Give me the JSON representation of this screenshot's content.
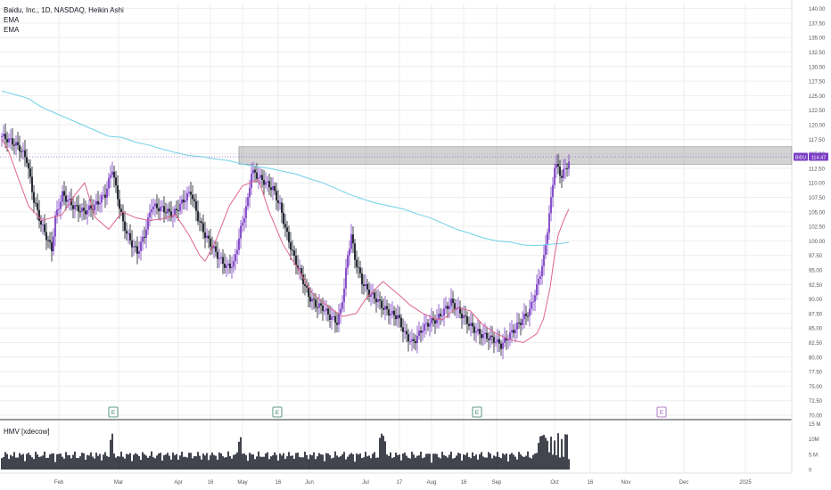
{
  "header": {
    "title": "Baidu, Inc., 1D, NASDAQ, Heikin Ashi",
    "ema_labels": [
      "EMA",
      "EMA"
    ]
  },
  "volume_pane": {
    "label": "HMV [xdecow]"
  },
  "colors": {
    "bull": "#7b3fc4",
    "bear": "#131722",
    "ema_fast": "#e0658a",
    "ema_slow": "#6fd0e8",
    "zone": "#9e9e9e",
    "grid": "#eeeeee",
    "price_tag": "#7b3fc4"
  },
  "chart_data": [
    {
      "type": "candlestick",
      "title": "Baidu, Inc., 1D, NASDAQ, Heikin Ashi",
      "x_tick_labels": [
        "Feb",
        "Mar",
        "Apr",
        "16",
        "May",
        "16",
        "Jun",
        "Jul",
        "17",
        "Aug",
        "16",
        "Sep",
        "Oct",
        "16",
        "Nov",
        "Dec",
        "2025"
      ],
      "y_tick_labels": [
        "70.00",
        "72.50",
        "75.00",
        "77.50",
        "80.00",
        "82.50",
        "85.00",
        "87.50",
        "90.00",
        "92.50",
        "95.00",
        "97.50",
        "100.00",
        "102.50",
        "105.00",
        "107.50",
        "110.00",
        "112.50",
        "115.00",
        "117.50",
        "120.00",
        "122.50",
        "125.00",
        "127.50",
        "130.00",
        "132.50",
        "135.00",
        "137.50",
        "140.00"
      ],
      "ylim": [
        70,
        140
      ],
      "grid": true,
      "last_price": {
        "symbol": "BIDU",
        "value": "114.47"
      },
      "resistance_zone": [
        113.2,
        116.2
      ],
      "earnings_markers": [
        {
          "label": "E",
          "date": "2024-03-12",
          "status": "past"
        },
        {
          "label": "E",
          "date": "2024-05-16",
          "status": "past"
        },
        {
          "label": "E",
          "date": "2024-08-22",
          "status": "past"
        },
        {
          "label": "E",
          "date": "2024-11-21",
          "status": "upcoming"
        }
      ],
      "series": [
        {
          "name": "EMA",
          "role": "fast",
          "points": [
            [
              0,
              117.5
            ],
            [
              5,
              115.5
            ],
            [
              12,
              111
            ],
            [
              20,
              106
            ],
            [
              30,
              103.5
            ],
            [
              45,
              104.5
            ],
            [
              55,
              108
            ],
            [
              62,
              110
            ],
            [
              70,
              104
            ],
            [
              80,
              102
            ],
            [
              90,
              105
            ],
            [
              100,
              104
            ],
            [
              110,
              103.5
            ],
            [
              120,
              103.8
            ],
            [
              130,
              104.5
            ],
            [
              140,
              101
            ],
            [
              148,
              97.5
            ],
            [
              152,
              96.5
            ],
            [
              160,
              100
            ],
            [
              170,
              106
            ],
            [
              180,
              109.5
            ],
            [
              192,
              110.5
            ],
            [
              200,
              105
            ],
            [
              210,
              99.5
            ],
            [
              222,
              95
            ],
            [
              232,
              91
            ],
            [
              245,
              88.5
            ],
            [
              255,
              87
            ],
            [
              265,
              87.5
            ],
            [
              272,
              90
            ],
            [
              285,
              93
            ],
            [
              298,
              90.5
            ],
            [
              305,
              89
            ],
            [
              315,
              87.5
            ],
            [
              325,
              86.5
            ],
            [
              330,
              86.5
            ],
            [
              340,
              88.5
            ],
            [
              350,
              88
            ],
            [
              360,
              85.5
            ],
            [
              370,
              84
            ],
            [
              380,
              83
            ],
            [
              390,
              82.5
            ],
            [
              400,
              84
            ],
            [
              405,
              86.5
            ],
            [
              410,
              92
            ],
            [
              413,
              97
            ],
            [
              416,
              101
            ],
            [
              420,
              103.5
            ],
            [
              424,
              105.5
            ]
          ]
        },
        {
          "name": "EMA",
          "role": "slow",
          "points": [
            [
              0,
              125.8
            ],
            [
              10,
              125.2
            ],
            [
              20,
              124.5
            ],
            [
              30,
              123
            ],
            [
              40,
              122
            ],
            [
              50,
              121
            ],
            [
              60,
              120
            ],
            [
              70,
              119
            ],
            [
              80,
              118
            ],
            [
              90,
              117.8
            ],
            [
              100,
              117
            ],
            [
              110,
              116.5
            ],
            [
              120,
              115.8
            ],
            [
              130,
              115.2
            ],
            [
              140,
              114.7
            ],
            [
              150,
              114.5
            ],
            [
              160,
              114.1
            ],
            [
              170,
              113.8
            ],
            [
              180,
              113.2
            ],
            [
              190,
              112.8
            ],
            [
              200,
              112.5
            ],
            [
              210,
              112
            ],
            [
              220,
              111.5
            ],
            [
              230,
              110.7
            ],
            [
              240,
              110
            ],
            [
              250,
              109
            ],
            [
              260,
              108
            ],
            [
              270,
              107.2
            ],
            [
              280,
              106.5
            ],
            [
              290,
              106
            ],
            [
              300,
              105.5
            ],
            [
              310,
              104.7
            ],
            [
              320,
              104
            ],
            [
              330,
              103
            ],
            [
              340,
              102
            ],
            [
              350,
              101.3
            ],
            [
              360,
              100.5
            ],
            [
              370,
              100
            ],
            [
              380,
              99.8
            ],
            [
              390,
              99.3
            ],
            [
              400,
              99.2
            ],
            [
              410,
              99.4
            ],
            [
              420,
              99.6
            ],
            [
              424,
              99.8
            ]
          ]
        }
      ],
      "volume_axis_labels": [
        "15 M",
        "10M",
        "5 M",
        "0"
      ],
      "volume_ylim": [
        0,
        15
      ]
    }
  ]
}
